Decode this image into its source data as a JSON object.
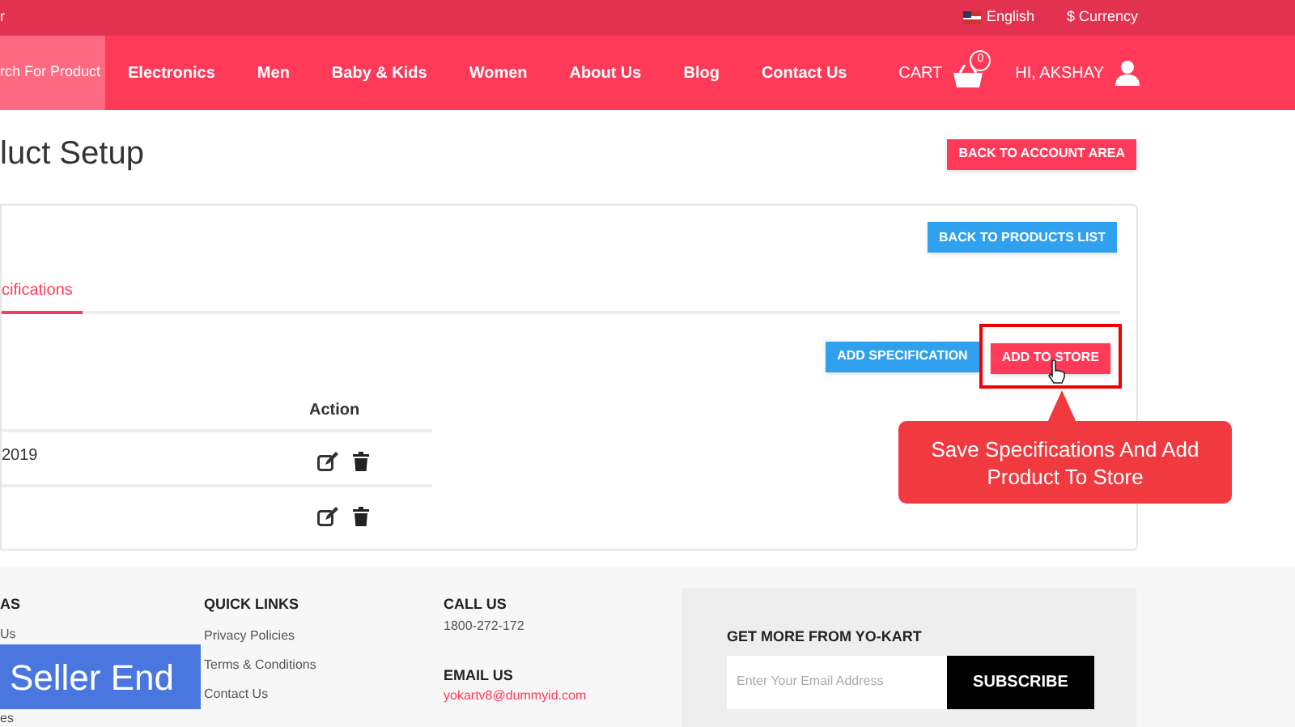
{
  "top_bar": {
    "left_text": "r",
    "language": "English",
    "currency": "$ Currency"
  },
  "nav": {
    "items": [
      {
        "label": "rch For Product",
        "selected": true
      },
      {
        "label": "Electronics",
        "selected": false
      },
      {
        "label": "Men",
        "selected": false
      },
      {
        "label": "Baby & Kids",
        "selected": false
      },
      {
        "label": "Women",
        "selected": false
      },
      {
        "label": "About Us",
        "selected": false
      },
      {
        "label": "Blog",
        "selected": false
      },
      {
        "label": "Contact Us",
        "selected": false
      }
    ],
    "cart": {
      "label": "CART",
      "count": "0"
    },
    "user": "HI, AKSHAY"
  },
  "page": {
    "title": "luct Setup",
    "back_button": "BACK TO ACCOUNT AREA"
  },
  "card": {
    "back_button": "BACK TO PRODUCTS LIST",
    "tabs": [
      {
        "label": "cifications",
        "selected": true
      }
    ],
    "add_spec_button": "ADD SPECIFICATION",
    "add_store_button": "ADD TO STORE",
    "highlighted": true,
    "table": {
      "columns": [
        "Action"
      ],
      "rows": [
        {
          "cell": "2019"
        },
        {
          "cell": ""
        }
      ]
    }
  },
  "callout": {
    "text": "Save Specifications And Add Product To Store"
  },
  "footer": {
    "columns": [
      {
        "heading": "AS",
        "links": [
          "Us",
          "es"
        ]
      },
      {
        "heading": "QUICK LINKS",
        "links": [
          "Privacy Policies",
          "Terms & Conditions",
          "Contact Us"
        ]
      }
    ],
    "call_heading": "CALL US",
    "phone": "1800-272-172",
    "email_heading": "EMAIL US",
    "email": "yokartv8@dummyid.com",
    "newsletter": {
      "heading": "GET MORE FROM YO-KART",
      "placeholder": "Enter Your Email Address",
      "button": "SUBSCRIBE"
    }
  },
  "overlay_label": "Seller End"
}
